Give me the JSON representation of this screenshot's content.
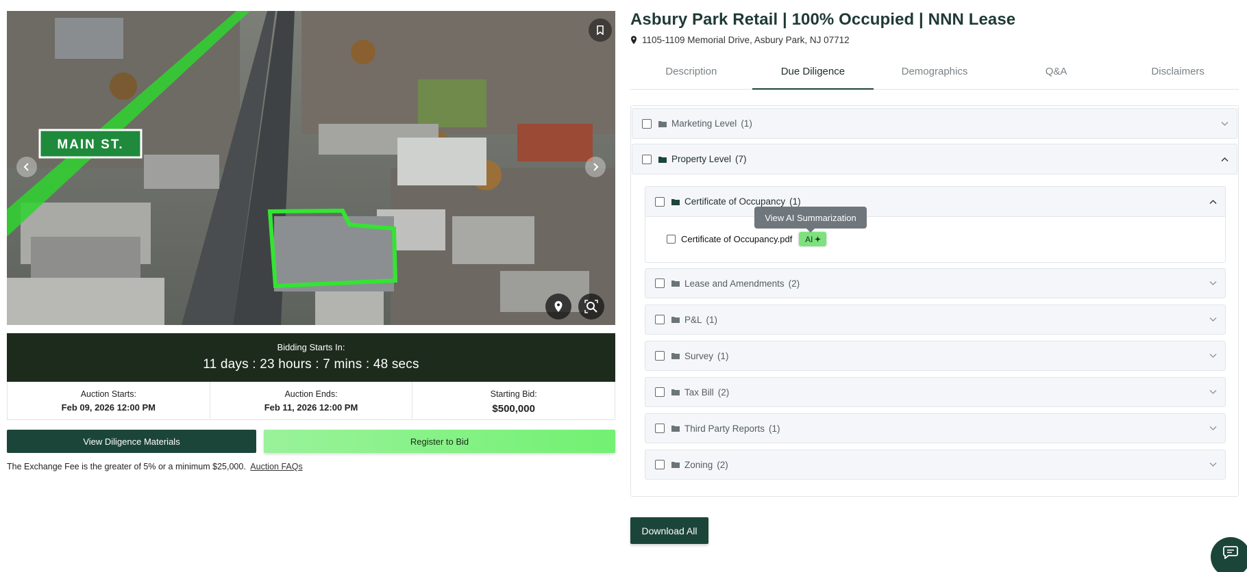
{
  "listing": {
    "title": "Asbury Park Retail | 100% Occupied | NNN Lease",
    "address": "1105-1109 Memorial Drive, Asbury Park, NJ 07712"
  },
  "hero": {
    "street_sign": "MAIN ST."
  },
  "countdown": {
    "label": "Bidding Starts In:",
    "value": "11 days : 23 hours : 7 mins : 48 secs"
  },
  "auction": {
    "starts_label": "Auction Starts:",
    "starts_value": "Feb 09, 2026 12:00 PM",
    "ends_label": "Auction Ends:",
    "ends_value": "Feb 11, 2026 12:00 PM",
    "bid_label": "Starting Bid:",
    "bid_value": "$500,000"
  },
  "actions": {
    "view_diligence": "View Diligence Materials",
    "register": "Register to Bid",
    "fee_note": "The Exchange Fee is the greater of 5% or a minimum $25,000.",
    "faq_link": "Auction FAQs",
    "download_all": "Download All"
  },
  "tabs": [
    "Description",
    "Due Diligence",
    "Demographics",
    "Q&A",
    "Disclaimers"
  ],
  "due_diligence": {
    "marketing": {
      "label": "Marketing Level",
      "count": "(1)"
    },
    "property": {
      "label": "Property Level",
      "count": "(7)"
    },
    "certificate": {
      "label": "Certificate of Occupancy",
      "count": "(1)"
    },
    "file_name": "Certificate of Occupancy.pdf",
    "ai_badge": "AI",
    "tooltip": "View AI Summarization",
    "folders": [
      {
        "label": "Lease and Amendments",
        "count": "(2)"
      },
      {
        "label": "P&L",
        "count": "(1)"
      },
      {
        "label": "Survey",
        "count": "(1)"
      },
      {
        "label": "Tax Bill",
        "count": "(2)"
      },
      {
        "label": "Third Party Reports",
        "count": "(1)"
      },
      {
        "label": "Zoning",
        "count": "(2)"
      }
    ]
  },
  "colors": {
    "brand_dark": "#1c4539",
    "accent_green": "#7de27d",
    "countdown_bg": "#1d2b1c"
  }
}
